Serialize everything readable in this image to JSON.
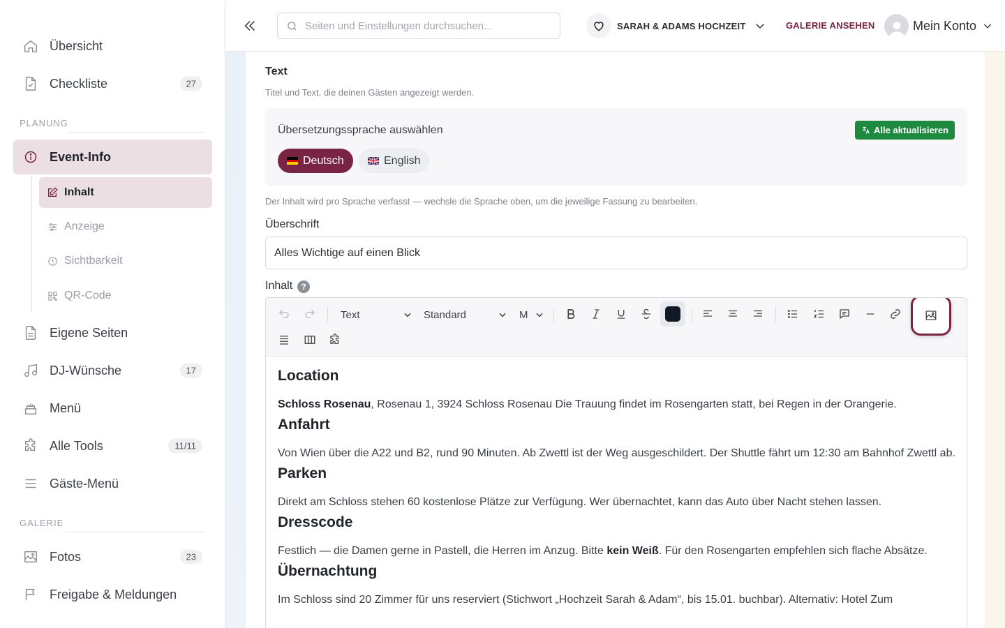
{
  "colors": {
    "brand": "#7a2444",
    "active_bg": "#ecdfe3",
    "success": "#1f8a3f",
    "text_color": "#121826"
  },
  "sidebar": {
    "top_items": [
      {
        "label": "Übersicht",
        "icon": "home-icon"
      },
      {
        "label": "Checkliste",
        "icon": "checklist-icon",
        "badge": "27"
      }
    ],
    "planning_title": "PLANUNG",
    "event_info": {
      "label": "Event-Info",
      "icon": "info-icon"
    },
    "sub_items": [
      {
        "label": "Inhalt",
        "icon": "edit-icon"
      },
      {
        "label": "Anzeige",
        "icon": "sliders-icon"
      },
      {
        "label": "Sichtbarkeit",
        "icon": "clock-icon"
      },
      {
        "label": "QR-Code",
        "icon": "qr-code-icon"
      }
    ],
    "planning_items": [
      {
        "label": "Eigene Seiten",
        "icon": "page-icon"
      },
      {
        "label": "DJ-Wünsche",
        "icon": "music-icon",
        "badge": "17"
      },
      {
        "label": "Menü",
        "icon": "cake-icon"
      },
      {
        "label": "Alle Tools",
        "icon": "puzzle-icon",
        "badge": "11/11"
      },
      {
        "label": "Gäste-Menü",
        "icon": "menu-icon"
      }
    ],
    "gallery_title": "GALERIE",
    "gallery_items": [
      {
        "label": "Fotos",
        "icon": "image-icon",
        "badge": "23"
      },
      {
        "label": "Freigabe & Meldungen",
        "icon": "flag-icon"
      }
    ]
  },
  "topbar": {
    "search_placeholder": "Seiten und Einstellungen durchsuchen...",
    "event_name": "SARAH & ADAMS HOCHZEIT",
    "gallery_link": "GALERIE ANSEHEN",
    "account_label": "Mein Konto"
  },
  "main": {
    "section_title": "Text",
    "section_subtitle": "Titel und Text, die deinen Gästen angezeigt werden.",
    "language_label": "Übersetzungssprache auswählen",
    "update_all": "Alle aktualisieren",
    "languages": [
      {
        "label": "Deutsch",
        "flag": "germany-flag-icon",
        "active": true
      },
      {
        "label": "English",
        "flag": "uk-flag-icon",
        "active": false
      }
    ],
    "language_hint": "Der Inhalt wird pro Sprache verfasst — wechsle die Sprache oben, um die jeweilige Fassung zu bearbeiten.",
    "headline_label": "Überschrift",
    "headline_value": "Alles Wichtige auf einen Blick",
    "content_label": "Inhalt",
    "help_glyph": "?"
  },
  "editor": {
    "block_type": "Text",
    "font_family": "Standard",
    "font_size": "M",
    "content": [
      {
        "heading": "Location",
        "paragraph": [
          {
            "b": "Schloss Rosenau"
          },
          ", Rosenau 1, 3924 Schloss Rosenau Die Trauung findet im Rosengarten statt, bei Regen in der Orangerie."
        ]
      },
      {
        "heading": "Anfahrt",
        "paragraph": [
          "Von Wien über die A22 und B2, rund 90 Minuten. Ab Zwettl ist der Weg ausgeschildert. Der Shuttle fährt um 12:30 am Bahnhof Zwettl ab."
        ]
      },
      {
        "heading": "Parken",
        "paragraph": [
          "Direkt am Schloss stehen 60 kostenlose Plätze zur Verfügung. Wer übernachtet, kann das Auto über Nacht stehen lassen."
        ]
      },
      {
        "heading": "Dresscode",
        "paragraph": [
          "Festlich — die Damen gerne in Pastell, die Herren im Anzug. Bitte ",
          {
            "b": "kein Weiß"
          },
          ". Für den Rosengarten empfehlen sich flache Absätze."
        ]
      },
      {
        "heading": "Übernachtung",
        "paragraph": [
          "Im Schloss sind 20 Zimmer für uns reserviert (Stichwort „Hochzeit Sarah & Adam“, bis 15.01. buchbar). Alternativ: Hotel Zum"
        ]
      }
    ]
  }
}
